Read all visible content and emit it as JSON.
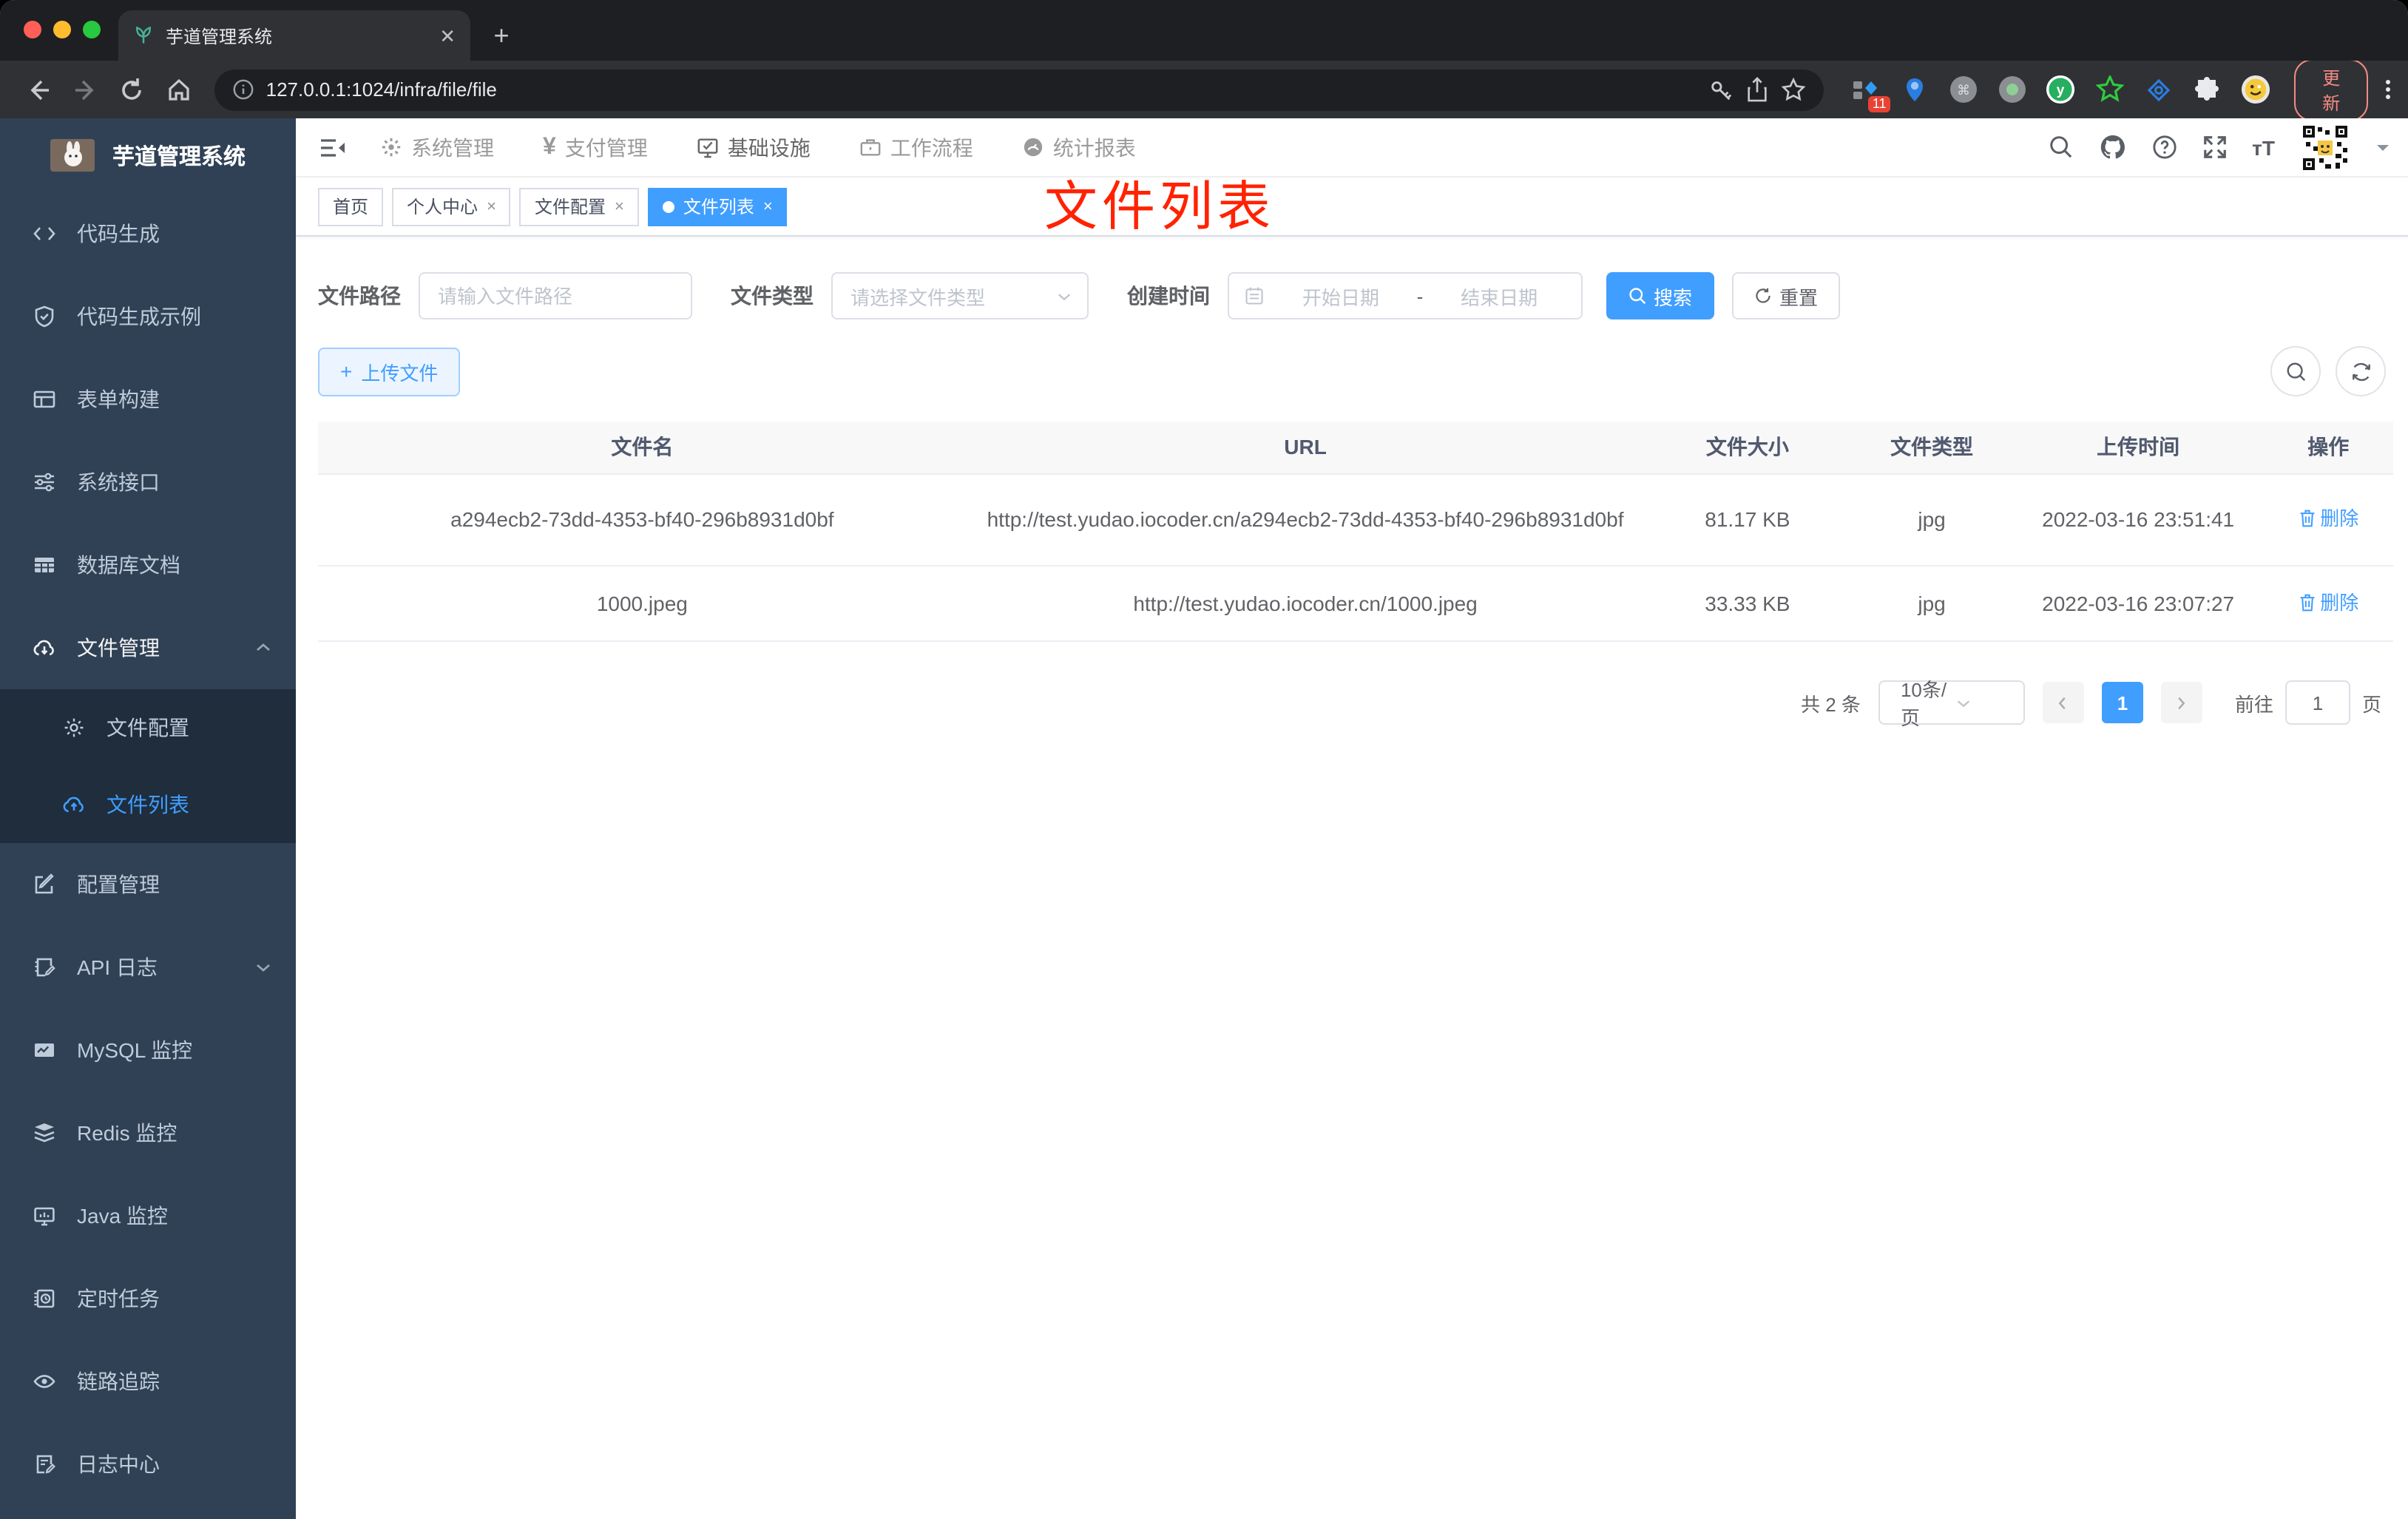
{
  "browser": {
    "tab_title": "芋道管理系统",
    "url": "127.0.0.1:1024/infra/file/file",
    "extension_badge": "11",
    "update_label": "更新"
  },
  "sidebar": {
    "logo_title": "芋道管理系统",
    "items": [
      {
        "label": "代码生成",
        "icon": "code-icon"
      },
      {
        "label": "代码生成示例",
        "icon": "shield-check-icon"
      },
      {
        "label": "表单构建",
        "icon": "form-icon"
      },
      {
        "label": "系统接口",
        "icon": "sliders-icon"
      },
      {
        "label": "数据库文档",
        "icon": "database-table-icon"
      },
      {
        "label": "文件管理",
        "icon": "cloud-download-icon",
        "expanded": true
      },
      {
        "label": "文件配置",
        "icon": "gear-icon",
        "submenu": true
      },
      {
        "label": "文件列表",
        "icon": "cloud-upload-icon",
        "submenu": true,
        "active": true
      },
      {
        "label": "配置管理",
        "icon": "edit-square-icon"
      },
      {
        "label": "API 日志",
        "icon": "document-edit-icon",
        "collapsed": true
      },
      {
        "label": "MySQL 监控",
        "icon": "chart-monitor-icon"
      },
      {
        "label": "Redis 监控",
        "icon": "layers-icon"
      },
      {
        "label": "Java 监控",
        "icon": "monitor-icon"
      },
      {
        "label": "定时任务",
        "icon": "scheduled-task-icon"
      },
      {
        "label": "链路追踪",
        "icon": "eye-icon"
      },
      {
        "label": "日志中心",
        "icon": "log-edit-icon"
      }
    ]
  },
  "topnav": {
    "items": [
      {
        "label": "系统管理",
        "icon": "gear-icon"
      },
      {
        "label": "支付管理",
        "icon": "yen-icon"
      },
      {
        "label": "基础设施",
        "icon": "monitor-check-icon",
        "active": true
      },
      {
        "label": "工作流程",
        "icon": "briefcase-icon"
      },
      {
        "label": "统计报表",
        "icon": "dashboard-icon"
      }
    ]
  },
  "tags": {
    "items": [
      {
        "label": "首页",
        "closable": false
      },
      {
        "label": "个人中心",
        "closable": true
      },
      {
        "label": "文件配置",
        "closable": true
      },
      {
        "label": "文件列表",
        "closable": true,
        "active": true
      }
    ],
    "close_glyph": "×"
  },
  "annotation": {
    "text": "文件列表",
    "color": "#ff2200"
  },
  "filters": {
    "path_label": "文件路径",
    "path_placeholder": "请输入文件路径",
    "type_label": "文件类型",
    "type_placeholder": "请选择文件类型",
    "time_label": "创建时间",
    "start_placeholder": "开始日期",
    "range_separator": "-",
    "end_placeholder": "结束日期",
    "search_label": "搜索",
    "reset_label": "重置"
  },
  "toolbar": {
    "upload_label": "上传文件"
  },
  "table": {
    "headers": [
      "文件名",
      "URL",
      "文件大小",
      "文件类型",
      "上传时间",
      "操作"
    ],
    "rows": [
      {
        "name": "a294ecb2-73dd-4353-bf40-296b8931d0bf",
        "url": "http://test.yudao.iocoder.cn/a294ecb2-73dd-4353-bf40-296b8931d0bf",
        "size": "81.17 KB",
        "type": "jpg",
        "time": "2022-03-16 23:51:41",
        "action": "删除"
      },
      {
        "name": "1000.jpeg",
        "url": "http://test.yudao.iocoder.cn/1000.jpeg",
        "size": "33.33 KB",
        "type": "jpg",
        "time": "2022-03-16 23:07:27",
        "action": "删除"
      }
    ]
  },
  "pagination": {
    "total": "共 2 条",
    "page_size": "10条/页",
    "current_page": "1",
    "goto_label": "前往",
    "goto_value": "1",
    "unit_label": "页"
  },
  "colors": {
    "accent": "#409eff",
    "sidebar_bg": "#304156",
    "submenu_bg": "#1f2d3d",
    "annotation_red": "#ff2200",
    "table_header_bg": "#f8f8f9"
  }
}
